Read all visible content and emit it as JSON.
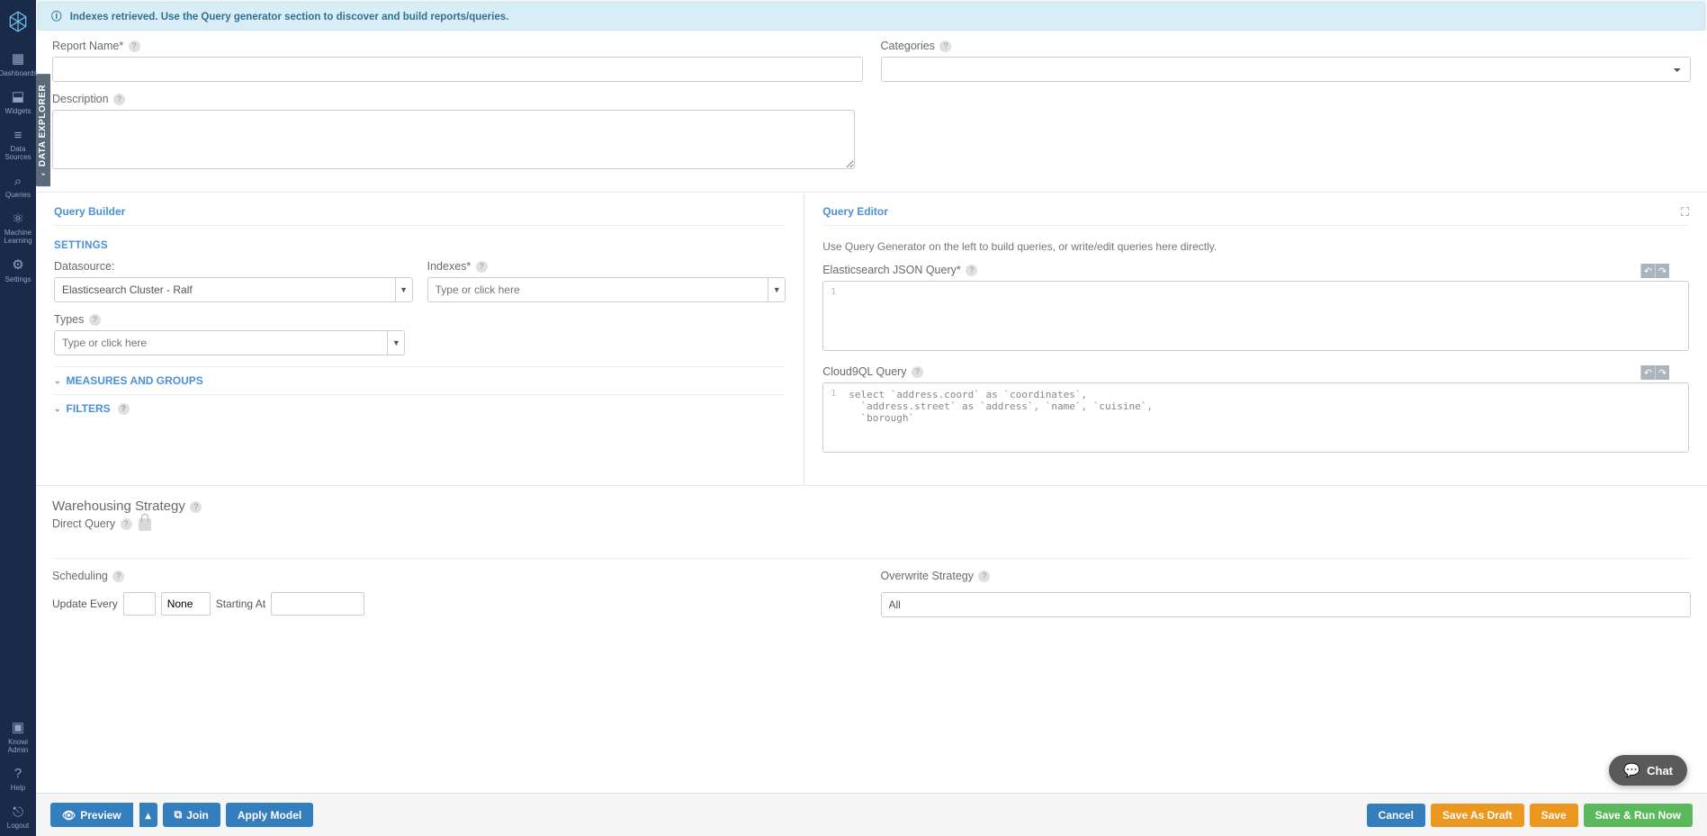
{
  "sidebar": {
    "items": [
      {
        "label": "Dashboards"
      },
      {
        "label": "Widgets"
      },
      {
        "label": "Data Sources"
      },
      {
        "label": "Queries"
      },
      {
        "label": "Machine Learning"
      },
      {
        "label": "Settings"
      }
    ],
    "bottom": [
      {
        "label": "Knowi Admin"
      },
      {
        "label": "Help"
      },
      {
        "label": "Logout"
      }
    ]
  },
  "alert": {
    "text": "Indexes retrieved. Use the Query generator section to discover and build reports/queries."
  },
  "form": {
    "report_name_label": "Report Name*",
    "categories_label": "Categories",
    "description_label": "Description"
  },
  "query_builder": {
    "title": "Query Builder",
    "settings_title": "SETTINGS",
    "datasource_label": "Datasource:",
    "datasource_value": "Elasticsearch Cluster - Ralf",
    "indexes_label": "Indexes*",
    "indexes_placeholder": "Type or click here",
    "types_label": "Types",
    "types_placeholder": "Type or click here",
    "measures_title": "MEASURES AND GROUPS",
    "filters_title": "FILTERS"
  },
  "query_editor": {
    "title": "Query Editor",
    "help_text": "Use Query Generator on the left to build queries, or write/edit queries here directly.",
    "es_label": "Elasticsearch JSON Query*",
    "es_value": "",
    "c9ql_label": "Cloud9QL Query",
    "c9ql_value": "select `address.coord` as `coordinates`,\n  `address.street` as `address`, `name`, `cuisine`,\n  `borough`"
  },
  "warehousing": {
    "title": "Warehousing Strategy",
    "direct_query_label": "Direct Query"
  },
  "scheduling": {
    "title": "Scheduling",
    "update_every_label": "Update Every",
    "unit_options": [
      "None"
    ],
    "unit_selected": "None",
    "starting_at_label": "Starting At"
  },
  "overwrite": {
    "title": "Overwrite Strategy",
    "value": "All"
  },
  "footer": {
    "preview": "Preview",
    "join": "Join",
    "apply_model": "Apply Model",
    "cancel": "Cancel",
    "save_draft": "Save As Draft",
    "save": "Save",
    "save_run": "Save & Run Now"
  },
  "chat": {
    "label": "Chat"
  },
  "vtab": {
    "label": "DATA EXPLORER"
  }
}
